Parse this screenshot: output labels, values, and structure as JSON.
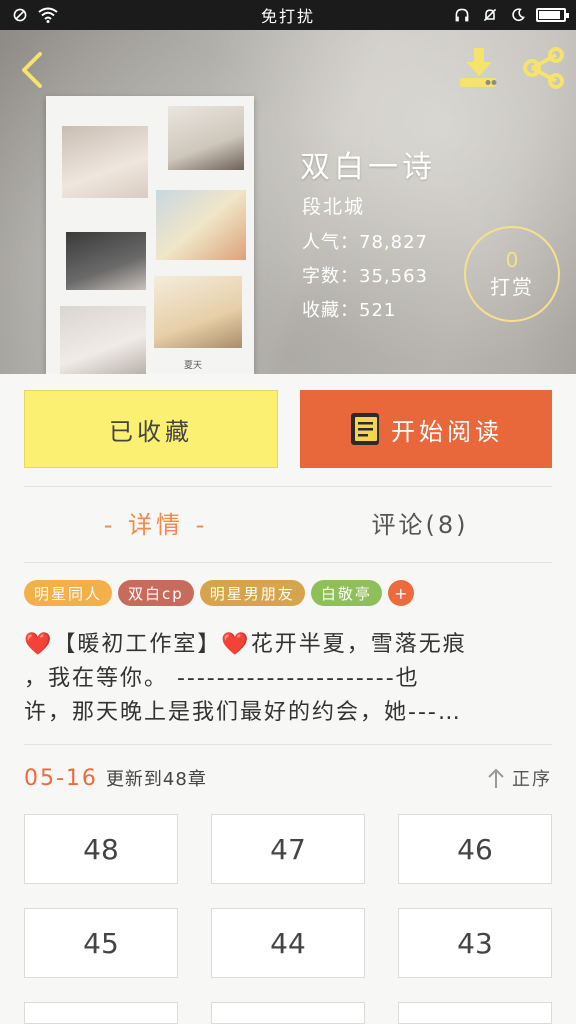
{
  "status_bar": {
    "title": "免打扰"
  },
  "book": {
    "title": "双白一诗",
    "author": "段北城",
    "popularity": "人气：78,827",
    "word_count": "字数：35,563",
    "favorites": "收藏：521",
    "cover_caption": "夏天"
  },
  "reward": {
    "count": "0",
    "label": "打赏"
  },
  "actions": {
    "collected_label": "已收藏",
    "read_label": "开始阅读"
  },
  "tabs": {
    "details": "- 详情 -",
    "comments": "评论(8)"
  },
  "tags": [
    {
      "label": "明星同人",
      "color": "#f3b04a"
    },
    {
      "label": "双白cp",
      "color": "#c76b5c"
    },
    {
      "label": "明星男朋友",
      "color": "#d6a44d"
    },
    {
      "label": "白敬亭",
      "color": "#8fbf5a"
    }
  ],
  "tag_more": "+",
  "description": {
    "line1": "❤️【暖初工作室】❤️花开半夏，雪落无痕",
    "line2": "，我在等你。 ----------------------也",
    "line3": "许，那天晚上是我们最好的约会，她---…"
  },
  "update": {
    "date": "05-16",
    "text": "更新到48章",
    "sort_label": "正序"
  },
  "chapters": [
    "48",
    "47",
    "46",
    "45",
    "44",
    "43",
    "",
    "",
    ""
  ]
}
